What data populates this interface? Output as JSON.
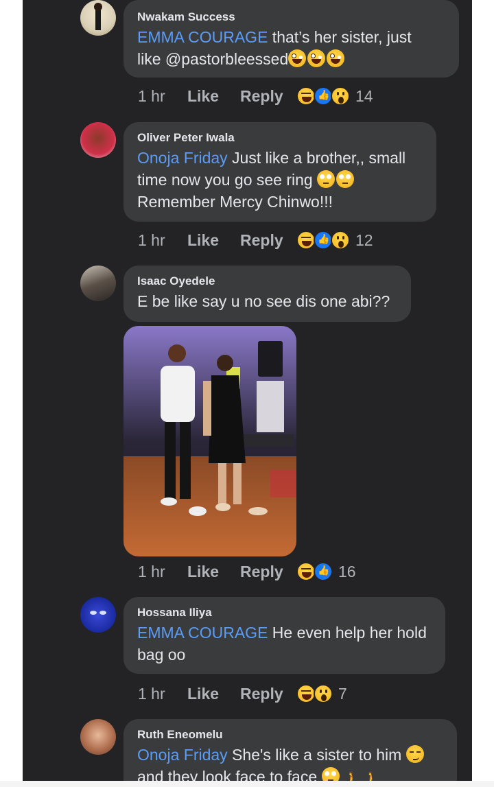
{
  "comments": [
    {
      "author": "Nwakam Success",
      "mention": "EMMA COURAGE",
      "text_line1": " that’s her sister, just",
      "text_line2": "like @pastorbleessed",
      "time": "1 hr",
      "like": "Like",
      "reply": "Reply",
      "reaction_count": "14",
      "reactions": [
        "haha",
        "like",
        "wow"
      ]
    },
    {
      "author": "Oliver Peter Iwala",
      "mention": "Onoja Friday",
      "text_line1": " Just like a brother,, small",
      "text_line2": "time now you go see ring",
      "text_line3": "Remember Mercy Chinwo!!!",
      "time": "1 hr",
      "like": "Like",
      "reply": "Reply",
      "reaction_count": "12",
      "reactions": [
        "haha",
        "like",
        "wow"
      ]
    },
    {
      "author": "Isaac Oyedele",
      "text_line1": "E be like say u no see dis one abi??",
      "time": "1 hr",
      "like": "Like",
      "reply": "Reply",
      "reaction_count": "16",
      "reactions": [
        "haha",
        "like"
      ]
    },
    {
      "author": "Hossana Iliya",
      "mention": "EMMA COURAGE",
      "text_line1": " He even help her hold",
      "text_line2": "bag oo",
      "time": "1 hr",
      "like": "Like",
      "reply": "Reply",
      "reaction_count": "7",
      "reactions": [
        "haha",
        "wow"
      ]
    },
    {
      "author": "Ruth Eneomelu",
      "mention": "Onoja Friday",
      "text_line1": " She's like a sister to him",
      "text_line2": "and they look face to face"
    }
  ],
  "colors": {
    "background": "#232325",
    "bubble": "#3a3b3c",
    "mention": "#5b9cf7",
    "meta": "#b0b3b8"
  },
  "icons": [
    "haha-reaction-icon",
    "like-reaction-icon",
    "wow-reaction-icon"
  ]
}
